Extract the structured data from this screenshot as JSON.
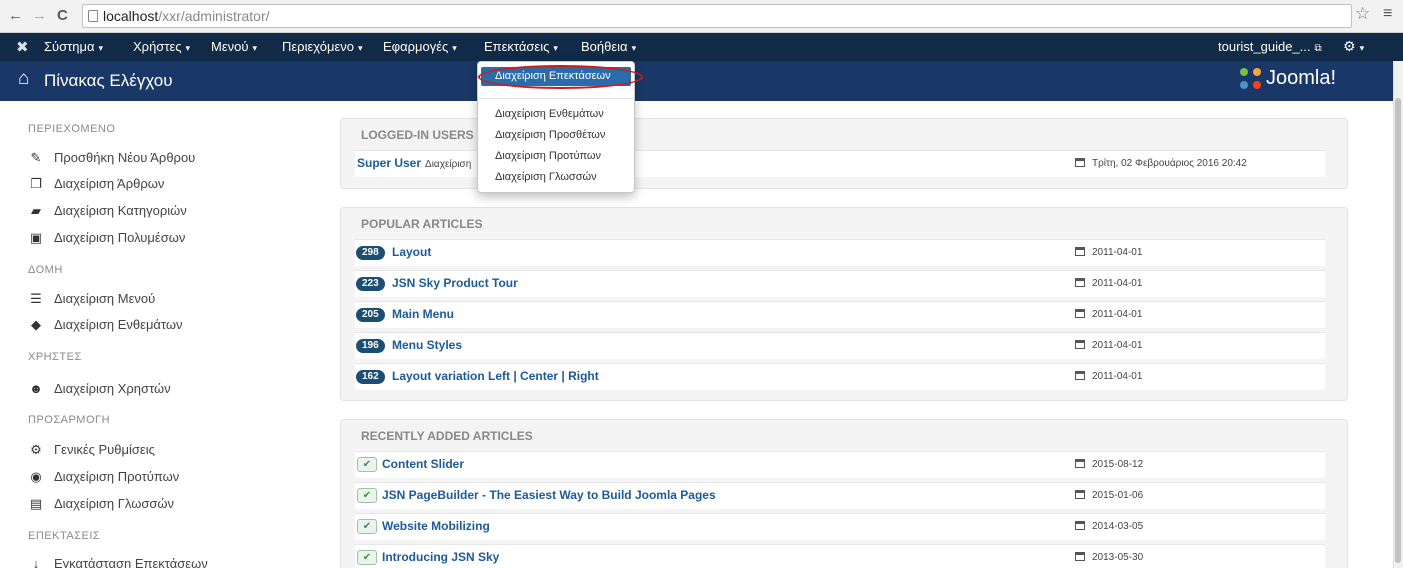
{
  "browser": {
    "back_glyph": "←",
    "forward_glyph": "→",
    "reload_glyph": "C",
    "url_host": "localhost",
    "url_path": "/xxr/administrator/",
    "star_glyph": "☆",
    "menu_glyph": "≡"
  },
  "nav": {
    "logo_glyph": "✖",
    "items": [
      "Σύστημα",
      "Χρήστες",
      "Μενού",
      "Περιεχόμενο",
      "Εφαρμογές",
      "Επεκτάσεις",
      "Βοήθεια"
    ],
    "caret": "▾",
    "user": "tourist_guide_...",
    "ext_glyph": "⧉",
    "gear_glyph": "⚙"
  },
  "header": {
    "home_glyph": "⌂",
    "title": "Πίνακας Ελέγχου",
    "logo_text": "Joomla!"
  },
  "sidebar": {
    "sections": [
      {
        "title": "ΠΕΡΙΕΧΟΜΕΝΟ",
        "items": [
          {
            "icon": "pencil-icon",
            "glyph": "✎",
            "label": "Προσθήκη Νέου Άρθρου"
          },
          {
            "icon": "articles-icon",
            "glyph": "❐",
            "label": "Διαχείριση Άρθρων"
          },
          {
            "icon": "folder-icon",
            "glyph": "▰",
            "label": "Διαχείριση Κατηγοριών"
          },
          {
            "icon": "image-icon",
            "glyph": "▣",
            "label": "Διαχείριση Πολυμέσων"
          }
        ]
      },
      {
        "title": "ΔΟΜΗ",
        "items": [
          {
            "icon": "list-icon",
            "glyph": "☰",
            "label": "Διαχείριση Μενού"
          },
          {
            "icon": "cube-icon",
            "glyph": "◆",
            "label": "Διαχείριση Ενθεμάτων"
          }
        ]
      },
      {
        "title": "ΧΡΗΣΤΕΣ",
        "items": [
          {
            "icon": "users-icon",
            "glyph": "☻",
            "label": "Διαχείριση Χρηστών"
          }
        ]
      },
      {
        "title": "ΠΡΟΣΑΡΜΟΓΗ",
        "items": [
          {
            "icon": "gear-icon",
            "glyph": "⚙",
            "label": "Γενικές Ρυθμίσεις"
          },
          {
            "icon": "eye-icon",
            "glyph": "◉",
            "label": "Διαχείριση Προτύπων"
          },
          {
            "icon": "comments-icon",
            "glyph": "▤",
            "label": "Διαχείριση Γλωσσών"
          }
        ]
      },
      {
        "title": "ΕΠΕΚΤΑΣΕΙΣ",
        "items": [
          {
            "icon": "download-icon",
            "glyph": "↓",
            "label": "Εγκατάσταση Επεκτάσεων"
          }
        ]
      }
    ]
  },
  "logged_in": {
    "title": "LOGGED-IN USERS",
    "rows": [
      {
        "name": "Super User",
        "sub": "Διαχείριση",
        "date": "Τρίτη, 02 Φεβρουάριος 2016 20:42"
      }
    ]
  },
  "popular": {
    "title": "POPULAR ARTICLES",
    "rows": [
      {
        "hits": "298",
        "title": "Layout",
        "date": "2011-04-01"
      },
      {
        "hits": "223",
        "title": "JSN Sky Product Tour",
        "date": "2011-04-01"
      },
      {
        "hits": "205",
        "title": "Main Menu",
        "date": "2011-04-01"
      },
      {
        "hits": "196",
        "title": "Menu Styles",
        "date": "2011-04-01"
      },
      {
        "hits": "162",
        "title": "Layout variation Left | Center | Right",
        "date": "2011-04-01"
      }
    ]
  },
  "recent": {
    "title": "RECENTLY ADDED ARTICLES",
    "check_glyph": "✔",
    "rows": [
      {
        "title": "Content Slider",
        "date": "2015-08-12"
      },
      {
        "title": "JSN PageBuilder - The Easiest Way to Build Joomla Pages",
        "date": "2015-01-06"
      },
      {
        "title": "Website Mobilizing",
        "date": "2014-03-05"
      },
      {
        "title": "Introducing JSN Sky",
        "date": "2013-05-30"
      }
    ]
  },
  "dropdown": {
    "highlighted": "Διαχείριση Επεκτάσεων",
    "items": [
      "Διαχείριση Ενθεμάτων",
      "Διαχείριση Προσθέτων",
      "Διαχείριση Προτύπων",
      "Διαχείριση Γλωσσών"
    ]
  },
  "colors": {
    "nav_bg": "#102a47",
    "header_bg": "#1a3867",
    "link": "#1c5a99",
    "badge": "#1b4e72",
    "highlight": "#2a6baa",
    "annotation": "#d11a1a"
  }
}
